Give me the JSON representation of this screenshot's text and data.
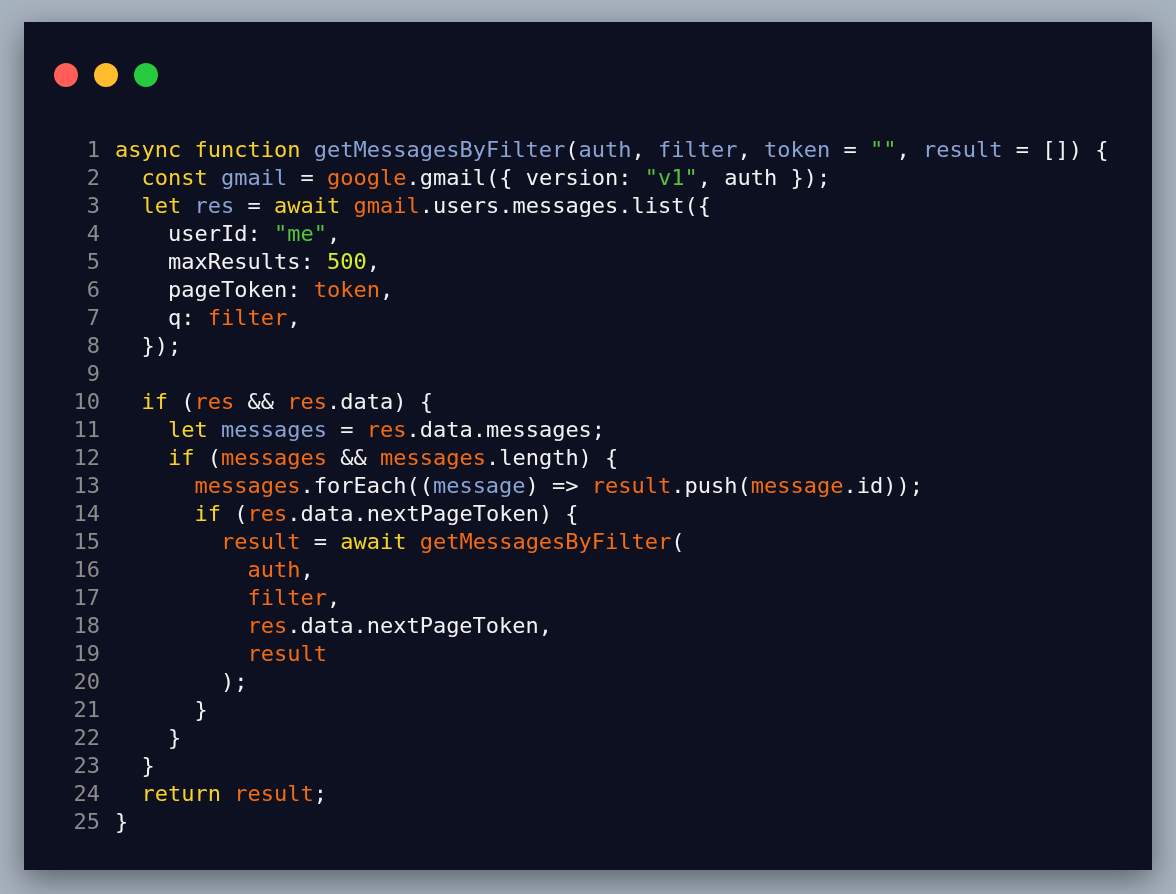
{
  "code": {
    "lines": [
      {
        "number": "1",
        "tokens": [
          {
            "kind": "keyword",
            "text": "async"
          },
          {
            "kind": "keyword",
            "text": " function"
          },
          {
            "kind": "declared",
            "text": " getMessagesByFilter"
          },
          {
            "kind": "plain",
            "text": "("
          },
          {
            "kind": "declared",
            "text": "auth"
          },
          {
            "kind": "plain",
            "text": ", "
          },
          {
            "kind": "declared",
            "text": "filter"
          },
          {
            "kind": "plain",
            "text": ", "
          },
          {
            "kind": "declared",
            "text": "token"
          },
          {
            "kind": "plain",
            "text": " = "
          },
          {
            "kind": "string",
            "text": "\"\""
          },
          {
            "kind": "plain",
            "text": ", "
          },
          {
            "kind": "declared",
            "text": "result"
          },
          {
            "kind": "plain",
            "text": " = []) {"
          }
        ]
      },
      {
        "number": "2",
        "tokens": [
          {
            "kind": "keyword",
            "text": "  const"
          },
          {
            "kind": "declared",
            "text": " gmail"
          },
          {
            "kind": "plain",
            "text": " = "
          },
          {
            "kind": "reference",
            "text": "google"
          },
          {
            "kind": "plain",
            "text": ".gmail({ version: "
          },
          {
            "kind": "string",
            "text": "\"v1\""
          },
          {
            "kind": "plain",
            "text": ", auth });"
          }
        ]
      },
      {
        "number": "3",
        "tokens": [
          {
            "kind": "keyword",
            "text": "  let"
          },
          {
            "kind": "declared",
            "text": " res"
          },
          {
            "kind": "plain",
            "text": " = "
          },
          {
            "kind": "keyword",
            "text": "await"
          },
          {
            "kind": "reference",
            "text": " gmail"
          },
          {
            "kind": "plain",
            "text": ".users.messages.list({"
          }
        ]
      },
      {
        "number": "4",
        "tokens": [
          {
            "kind": "plain",
            "text": "    userId: "
          },
          {
            "kind": "string",
            "text": "\"me\""
          },
          {
            "kind": "plain",
            "text": ","
          }
        ]
      },
      {
        "number": "5",
        "tokens": [
          {
            "kind": "plain",
            "text": "    maxResults: "
          },
          {
            "kind": "number",
            "text": "500"
          },
          {
            "kind": "plain",
            "text": ","
          }
        ]
      },
      {
        "number": "6",
        "tokens": [
          {
            "kind": "plain",
            "text": "    pageToken: "
          },
          {
            "kind": "reference",
            "text": "token"
          },
          {
            "kind": "plain",
            "text": ","
          }
        ]
      },
      {
        "number": "7",
        "tokens": [
          {
            "kind": "plain",
            "text": "    q: "
          },
          {
            "kind": "reference",
            "text": "filter"
          },
          {
            "kind": "plain",
            "text": ","
          }
        ]
      },
      {
        "number": "8",
        "tokens": [
          {
            "kind": "plain",
            "text": "  });"
          }
        ]
      },
      {
        "number": "9"
      },
      {
        "number": "10",
        "tokens": [
          {
            "kind": "keyword",
            "text": "  if"
          },
          {
            "kind": "plain",
            "text": " ("
          },
          {
            "kind": "reference",
            "text": "res"
          },
          {
            "kind": "plain",
            "text": " && "
          },
          {
            "kind": "reference",
            "text": "res"
          },
          {
            "kind": "plain",
            "text": ".data) {"
          }
        ]
      },
      {
        "number": "11",
        "tokens": [
          {
            "kind": "keyword",
            "text": "    let"
          },
          {
            "kind": "declared",
            "text": " messages"
          },
          {
            "kind": "plain",
            "text": " = "
          },
          {
            "kind": "reference",
            "text": "res"
          },
          {
            "kind": "plain",
            "text": ".data.messages;"
          }
        ]
      },
      {
        "number": "12",
        "tokens": [
          {
            "kind": "keyword",
            "text": "    if"
          },
          {
            "kind": "plain",
            "text": " ("
          },
          {
            "kind": "reference",
            "text": "messages"
          },
          {
            "kind": "plain",
            "text": " && "
          },
          {
            "kind": "reference",
            "text": "messages"
          },
          {
            "kind": "plain",
            "text": ".length) {"
          }
        ]
      },
      {
        "number": "13",
        "tokens": [
          {
            "kind": "reference",
            "text": "      messages"
          },
          {
            "kind": "plain",
            "text": ".forEach(("
          },
          {
            "kind": "declared",
            "text": "message"
          },
          {
            "kind": "plain",
            "text": ") => "
          },
          {
            "kind": "reference",
            "text": "result"
          },
          {
            "kind": "plain",
            "text": ".push("
          },
          {
            "kind": "reference",
            "text": "message"
          },
          {
            "kind": "plain",
            "text": ".id));"
          }
        ]
      },
      {
        "number": "14",
        "tokens": [
          {
            "kind": "keyword",
            "text": "      if"
          },
          {
            "kind": "plain",
            "text": " ("
          },
          {
            "kind": "reference",
            "text": "res"
          },
          {
            "kind": "plain",
            "text": ".data.nextPageToken) {"
          }
        ]
      },
      {
        "number": "15",
        "tokens": [
          {
            "kind": "reference",
            "text": "        result"
          },
          {
            "kind": "plain",
            "text": " = "
          },
          {
            "kind": "keyword",
            "text": "await"
          },
          {
            "kind": "reference",
            "text": " getMessagesByFilter"
          },
          {
            "kind": "plain",
            "text": "("
          }
        ]
      },
      {
        "number": "16",
        "tokens": [
          {
            "kind": "reference",
            "text": "          auth"
          },
          {
            "kind": "plain",
            "text": ","
          }
        ]
      },
      {
        "number": "17",
        "tokens": [
          {
            "kind": "reference",
            "text": "          filter"
          },
          {
            "kind": "plain",
            "text": ","
          }
        ]
      },
      {
        "number": "18",
        "tokens": [
          {
            "kind": "reference",
            "text": "          res"
          },
          {
            "kind": "plain",
            "text": ".data.nextPageToken,"
          }
        ]
      },
      {
        "number": "19",
        "tokens": [
          {
            "kind": "reference",
            "text": "          result"
          }
        ]
      },
      {
        "number": "20",
        "tokens": [
          {
            "kind": "plain",
            "text": "        );"
          }
        ]
      },
      {
        "number": "21",
        "tokens": [
          {
            "kind": "plain",
            "text": "      }"
          }
        ]
      },
      {
        "number": "22",
        "tokens": [
          {
            "kind": "plain",
            "text": "    }"
          }
        ]
      },
      {
        "number": "23",
        "tokens": [
          {
            "kind": "plain",
            "text": "  }"
          }
        ]
      },
      {
        "number": "24",
        "tokens": [
          {
            "kind": "keyword",
            "text": "  return"
          },
          {
            "kind": "reference",
            "text": " result"
          },
          {
            "kind": "plain",
            "text": ";"
          }
        ]
      },
      {
        "number": "25",
        "tokens": [
          {
            "kind": "plain",
            "text": "}"
          }
        ]
      }
    ]
  }
}
